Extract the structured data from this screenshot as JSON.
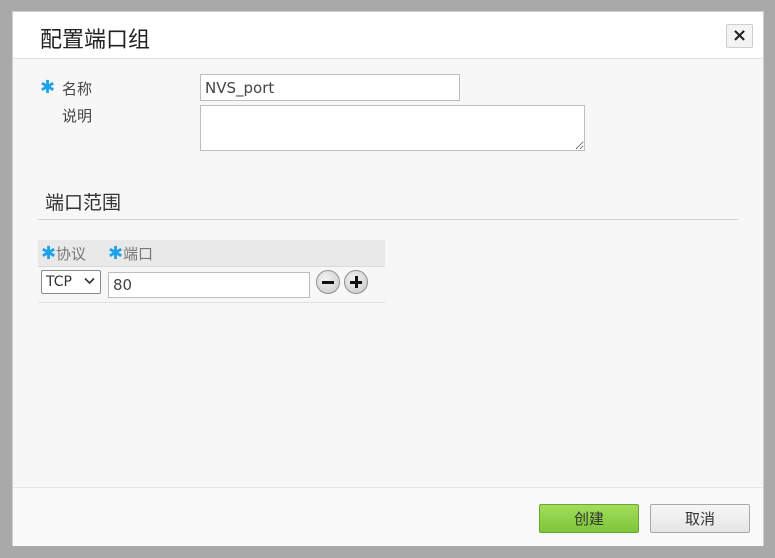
{
  "dialog": {
    "title": "配置端口组",
    "close_label": "×"
  },
  "form": {
    "required_mark": "✱",
    "name_label": "名称",
    "name_value": "NVS_port",
    "desc_label": "说明",
    "desc_value": ""
  },
  "port_range": {
    "section_title": "端口范围",
    "col_protocol": "协议",
    "col_port": "端口",
    "rows": [
      {
        "protocol": "TCP",
        "port": "80"
      }
    ]
  },
  "footer": {
    "create_label": "创建",
    "cancel_label": "取消"
  },
  "colors": {
    "accent_required": "#1ea1e8",
    "create_button": "#8ed04a"
  },
  "icons": {
    "close": "close-icon",
    "remove_row": "minus-icon",
    "add_row": "plus-icon",
    "select_arrow": "chevron-down-icon"
  }
}
